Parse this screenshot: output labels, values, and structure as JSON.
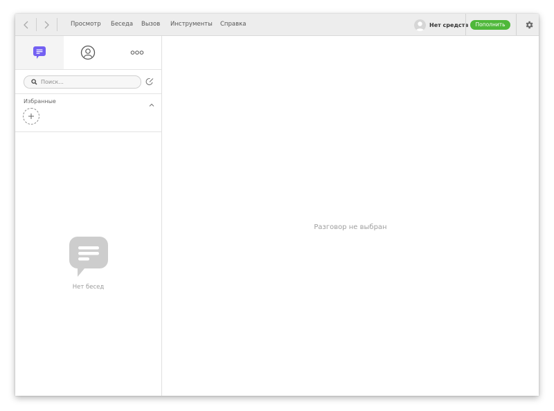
{
  "topbar": {
    "menu": [
      "Просмотр",
      "Беседа",
      "Вызов",
      "Инструменты",
      "Справка"
    ],
    "balance_text": "Нет средств",
    "topup_label": "Пополнить"
  },
  "sidebar": {
    "tabs": [
      {
        "name": "chats",
        "icon": "chat-bubble-icon",
        "active": true
      },
      {
        "name": "contacts",
        "icon": "contact-icon",
        "active": false
      },
      {
        "name": "more",
        "icon": "more-dots-icon",
        "active": false
      }
    ],
    "search": {
      "placeholder": "Поиск...",
      "value": ""
    },
    "favorites": {
      "title": "Избранные"
    },
    "empty_text": "Нет бесед"
  },
  "main": {
    "empty_text": "Разговор не выбран"
  },
  "colors": {
    "accent": "#7360f2",
    "topup": "#4fb83a",
    "topbar_bg": "#ededed"
  }
}
